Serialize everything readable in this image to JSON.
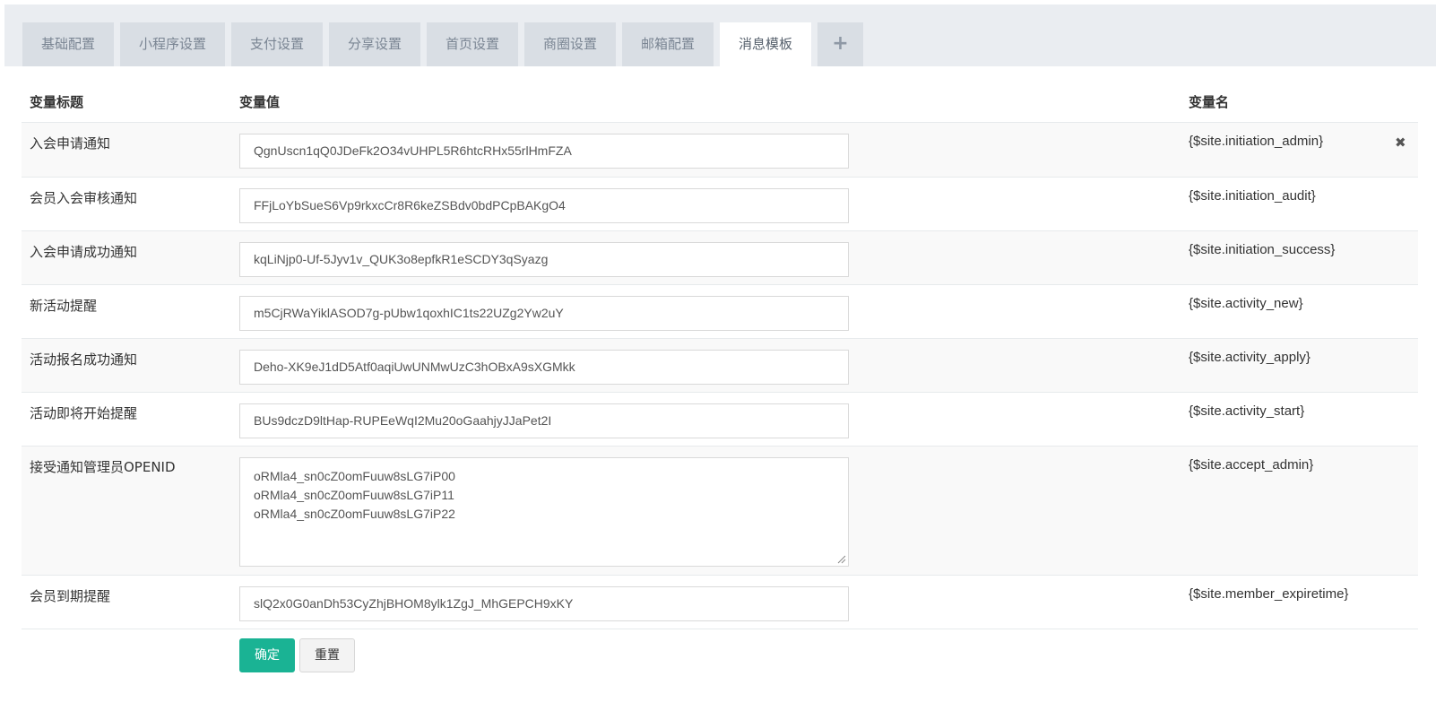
{
  "tabs": [
    {
      "label": "基础配置"
    },
    {
      "label": "小程序设置"
    },
    {
      "label": "支付设置"
    },
    {
      "label": "分享设置"
    },
    {
      "label": "首页设置"
    },
    {
      "label": "商圈设置"
    },
    {
      "label": "邮箱配置"
    },
    {
      "label": "消息模板",
      "active": true
    }
  ],
  "add_tab_label": "+",
  "table": {
    "headers": {
      "title": "变量标题",
      "value": "变量值",
      "name": "变量名"
    },
    "rows": [
      {
        "title": "入会申请通知",
        "value": "QgnUscn1qQ0JDeFk2O34vUHPL5R6htcRHx55rlHmFZA",
        "var": "{$site.initiation_admin}"
      },
      {
        "title": "会员入会审核通知",
        "value": "FFjLoYbSueS6Vp9rkxcCr8R6keZSBdv0bdPCpBAKgO4",
        "var": "{$site.initiation_audit}"
      },
      {
        "title": "入会申请成功通知",
        "value": "kqLiNjp0-Uf-5Jyv1v_QUK3o8epfkR1eSCDY3qSyazg",
        "var": "{$site.initiation_success}"
      },
      {
        "title": "新活动提醒",
        "value": "m5CjRWaYiklASOD7g-pUbw1qoxhIC1ts22UZg2Yw2uY",
        "var": "{$site.activity_new}"
      },
      {
        "title": "活动报名成功通知",
        "value": "Deho-XK9eJ1dD5Atf0aqiUwUNMwUzC3hOBxA9sXGMkk",
        "var": "{$site.activity_apply}"
      },
      {
        "title": "活动即将开始提醒",
        "value": "BUs9dczD9ltHap-RUPEeWqI2Mu20oGaahjyJJaPet2I",
        "var": "{$site.activity_start}"
      },
      {
        "title": "接受通知管理员OPENID",
        "lines": [
          "oRMla4_sn0cZ0omFuuw8sLG7iP00",
          "oRMla4_sn0cZ0omFuuw8sLG7iP11",
          "oRMla4_sn0cZ0omFuuw8sLG7iP22"
        ],
        "var": "{$site.accept_admin}"
      },
      {
        "title": "会员到期提醒",
        "value": "slQ2x0G0anDh53CyZhjBHOM8ylk1ZgJ_MhGEPCH9xKY",
        "var": "{$site.member_expiretime}"
      }
    ]
  },
  "icons": {
    "delete": "close-icon",
    "add": "plus-icon"
  },
  "buttons": {
    "confirm": "确定",
    "reset": "重置"
  },
  "colors": {
    "primary": "#1ab394",
    "tab_bg": "#d9dee4",
    "band_bg": "#eaedf1"
  }
}
